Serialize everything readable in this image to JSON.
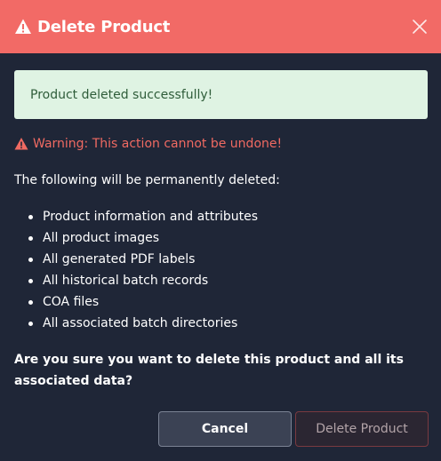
{
  "dialog": {
    "title": "Delete Product",
    "accent_color": "#f26a66"
  },
  "success_alert": {
    "text": "Product deleted successfully!"
  },
  "warning": {
    "text": "Warning: This action cannot be undone!",
    "color": "#f06a62"
  },
  "intro": "The following will be permanently deleted:",
  "items": [
    "Product information and attributes",
    "All product images",
    "All generated PDF labels",
    "All historical batch records",
    "COA files",
    "All associated batch directories"
  ],
  "question": "Are you sure you want to delete this product and all its associated data?",
  "buttons": {
    "cancel": "Cancel",
    "delete": "Delete Product"
  },
  "icons": {
    "header": "warning-triangle-icon",
    "close": "close-icon",
    "warning": "warning-triangle-icon"
  }
}
